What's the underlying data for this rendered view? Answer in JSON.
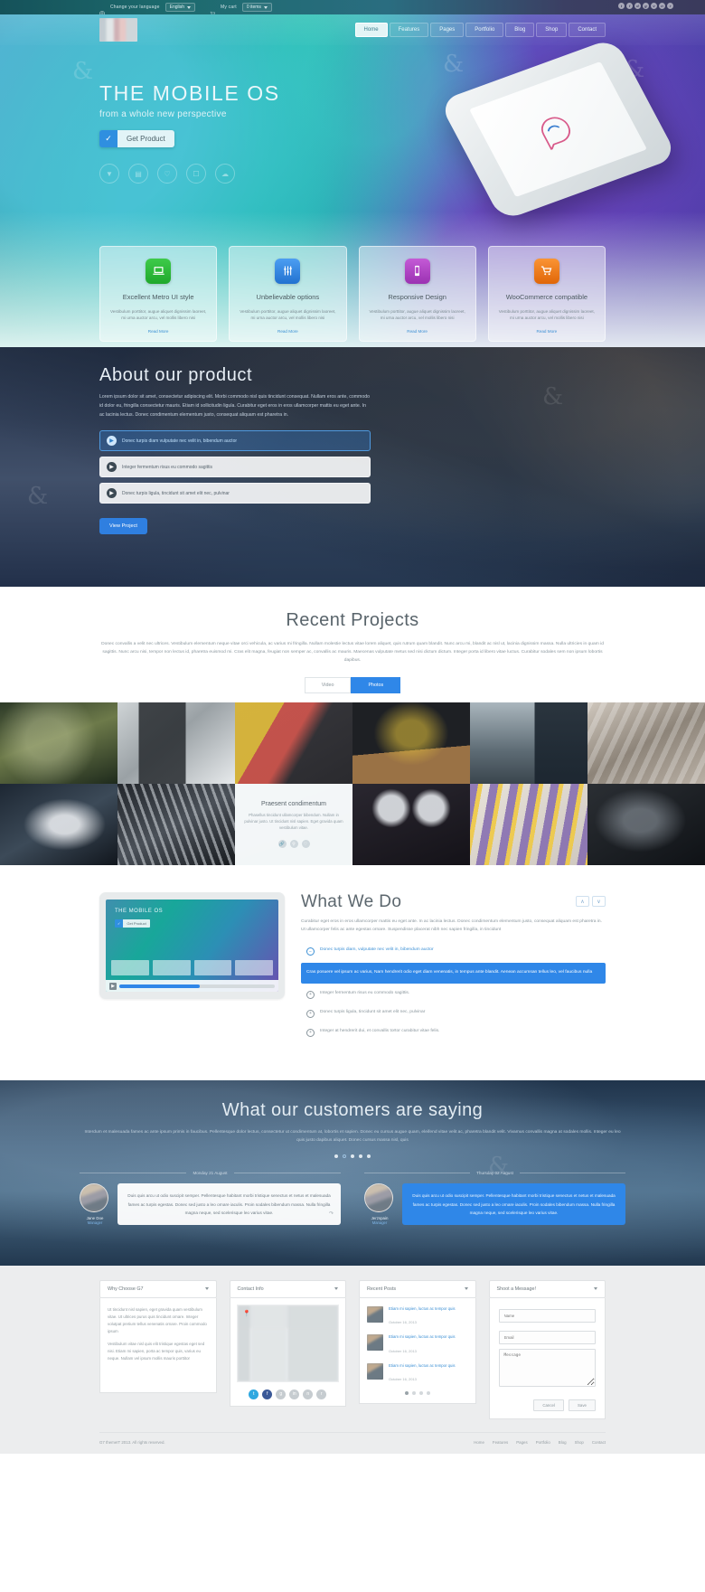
{
  "topbar": {
    "language_label": "Change your language",
    "language_value": "English",
    "cart_label": "My cart",
    "cart_value": "0 items",
    "globe_icon": "globe-icon",
    "cart_icon": "cart-icon",
    "social": [
      "twitter",
      "facebook",
      "dribbble",
      "google-plus",
      "vimeo",
      "flickr",
      "rss"
    ]
  },
  "nav": {
    "logo_alt": "site-logo",
    "items": [
      {
        "label": "Home",
        "active": true
      },
      {
        "label": "Features",
        "active": false
      },
      {
        "label": "Pages",
        "active": false
      },
      {
        "label": "Portfolio",
        "active": false
      },
      {
        "label": "Blog",
        "active": false
      },
      {
        "label": "Shop",
        "active": false
      },
      {
        "label": "Contact",
        "active": false
      }
    ]
  },
  "hero": {
    "title": "THE MOBILE OS",
    "subtitle": "from a whole new perspective",
    "button_label": "Get Product",
    "button_icon": "check-icon",
    "icons": [
      "filter-icon",
      "video-icon",
      "heart-icon",
      "camera-icon",
      "cloud-icon"
    ]
  },
  "features": [
    {
      "icon": "laptop-icon",
      "color": "#2dbb39",
      "title": "Excellent Metro\nUI style",
      "desc": "Vestibulum porttitor, augue aliquet dignissim laoreet, mi urna auctor arcu, vel mollis libero nisi",
      "more": "Read More"
    },
    {
      "icon": "sliders-icon",
      "color": "#2f87e8",
      "title": "Unbelievable\noptions",
      "desc": "Vestibulum porttitor, augue aliquet dignissim laoreet, mi urna auctor arcu, vel mollis libero nisi",
      "more": "Read More"
    },
    {
      "icon": "mobile-icon",
      "color": "#b44bc6",
      "title": "Responsive\nDesign",
      "desc": "Vestibulum porttitor, augue aliquet dignissim laoreet, mi urna auctor arcu, vel mollis libero nisi",
      "more": "Read More"
    },
    {
      "icon": "cart-badge-icon",
      "color": "#ef7a1e",
      "title": "WooCommerce\ncompatible",
      "desc": "Vestibulum porttitor, augue aliquet dignissim laoreet, mi urna auctor arcu, vel mollis libero nisi",
      "more": "Read More"
    }
  ],
  "about": {
    "title": "About our product",
    "paragraph": "Lorem ipsum dolor sit amet, consectetur adipiscing elit. Morbi commodo nisl quis tincidunt consequat. Nullam eros ante, commodo id dolor eu, fringilla consectetur mauris. Etiam id sollicitudin ligula. Curabitur eget eros in eros ullamcorper mattis eu eget ante. In ac lacinia lectus. Donec condimentum elementum justo, consequat aliquam est pharetra in.",
    "accordion": [
      {
        "text": "Donec turpis diam vulputate nec velit in, bibendum auctor",
        "open": true,
        "icon": "play-icon"
      },
      {
        "text": "Integer fermentum risus eu commodo sagittis",
        "open": false,
        "icon": "play-icon"
      },
      {
        "text": "Donec turpis ligula, tincidunt sit amet elit nec, pulvinar",
        "open": false,
        "icon": "play-icon"
      }
    ],
    "button_label": "View Project"
  },
  "projects": {
    "title": "Recent Projects",
    "paragraph": "Donec convallis a velit nec ultrices. Vestibulum elementum neque vitae orci vehicula, ac varius mi fringilla. Nullam molestie lectus vitae lorem aliquet, quis rutrum quam blandit. Nunc arcu mi, blandit ac nisl ut, lacinia dignissim massa. Nulla ultricies in quam id sagittis. Nunc arcu nisi, tempor non lectus id, pharetra euismod mi. Cras elit magna, feugiat non semper ac, convallis ac mauris. Maecenas vulputate metus sed nisi dictum dictum. Integer porta id libero vitae luctus. Curabitur sodales sem non ipsum lobortis dapibus.",
    "tabs": [
      {
        "label": "Video",
        "selected": false
      },
      {
        "label": "Photos",
        "selected": true
      }
    ],
    "caption_card": {
      "title": "Praesent condimentum",
      "desc": "Phasellus tincidunt ullamcorper bibendum. Nullam in pulvinar justo. Ut tincidunt nisl sapien. Eget gravida quam vestibulum vitae.",
      "actions": [
        "link-icon",
        "search-icon",
        "heart-icon"
      ]
    },
    "tile_labels": [
      "book-cover-tile",
      "tablet-device-tile",
      "phone-apps-tile",
      "desk-imac-tile",
      "mountain-brightness-tile",
      "sheets-tile",
      "fabric-tile",
      "sneakers-tile",
      "caption-tile",
      "reel-to-reel-tile",
      "synth-keys-tile",
      "dark-product-tile"
    ]
  },
  "what_we_do": {
    "title": "What We Do",
    "paragraph": "Curabitur eget eros in eros ullamcorper mattis eu eget ante. In ac lacinia lectus. Donec condimentum elementum justo, consequat aliquam est pharetra in. Ut ullamcorper felis ac ante egestas ornare. Suspendisse placerat nibh nec sapien fringilla, in tincidunt",
    "prev_icon": "chevron-up-icon",
    "next_icon": "chevron-down-icon",
    "tablet": {
      "title": "THE MOBILE OS",
      "button_label": "Get Product",
      "play_icon": "play-icon",
      "progress": 52
    },
    "items": [
      {
        "text": "Donec turpis diam, vulputate nec velit in, bibendum auctor",
        "state": "link"
      },
      {
        "text": "Cras posuere vel ipsum ac varius, Nam hendrerit odio eget diam venenatis, in tempus ante blandit. Aenean accumsan tellus leo, vel faucibus nulla",
        "state": "open"
      },
      {
        "text": "Integer fermentum risus eu commodo sagittis.",
        "state": "plain"
      },
      {
        "text": "Donec turpis ligula, tincidunt sit amet elit nec, pulvinar",
        "state": "plain"
      },
      {
        "text": "Integer at hendrerit dui, et convallis tortor curabitur vitae felis.",
        "state": "plain"
      }
    ]
  },
  "testimonials": {
    "title": "What our customers are saying",
    "paragraph": "Interdum et malesuada fames ac ante ipsum primis in faucibus. Pellentesque dolor lectus, consectetur ut condimentum at, lobortis et sapien. Donec eu cursus augue quam, eleifend vitae velit ac, pharetra blandit velit. Vivamus convallis magna at sodales mollis. Integer eu leo quis justo dapibus aliquet. Donec cursus massa nisl, quis",
    "dots": [
      true,
      false,
      true,
      true,
      true
    ],
    "items": [
      {
        "date": "Monday 21 August",
        "name": "Jane Doe",
        "role": "Manager",
        "quote": "Duis quis arcu ut odio suscipit semper. Pellentesque habitant morbi tristique senectus et netus et malesuada fames ac turpis egestas. Donec sed justo a leo ornare iaculis. Proin sodales bibendum massa. Nulla fringilla magna neque, sed scelerisque leo varius vitae.",
        "highlight": false,
        "share_icon": "share-icon"
      },
      {
        "date": "Thursday 02 August",
        "name": "Jerzspain",
        "role": "Manager",
        "quote": "Duis quis arcu ut odio suscipit semper. Pellentesque habitant morbi tristique senectus et netus et malesuada fames ac turpis egestas. Donec sed justo a leo ornare iaculis. Proin sodales bibendum massa. Nulla fringilla magna neque, sed scelerisque leo varius vitae.",
        "highlight": true,
        "share_icon": "share-icon"
      }
    ]
  },
  "footer": {
    "widgets": [
      {
        "title": "Why Choose G7",
        "caret": "chevron-down-icon",
        "paragraphs": [
          "Ut tincidunt nisl sapien, eget gravida quam vestibulum vitae. Ut ultrices purus quis tincidunt ornare. Integer volutpat pretium tellus venenatis ornare. Proin commodo ipsum",
          "Vestibulum vitae nisl quis elit tristique egestas eget sed nisi. Etiam mi sapien, porta ac tempor quis, varius eu neque. Nullam vel ipsum mollis mauris porttitor"
        ]
      },
      {
        "title": "Contact Info",
        "caret": "chevron-down-icon",
        "map_icon": "map-pin-icon",
        "socials": [
          "twitter",
          "facebook",
          "google-plus",
          "linkedin",
          "flickr",
          "rss"
        ]
      },
      {
        "title": "Recent Posts",
        "caret": "chevron-down-icon",
        "posts": [
          {
            "title": "Etiam mi sapien, luctus ac tempor quis",
            "date": "October 16, 2013"
          },
          {
            "title": "Etiam mi sapien, luctus ac tempor quis",
            "date": "October 16, 2013"
          },
          {
            "title": "Etiam mi sapien, luctus ac tempor quis",
            "date": "October 16, 2013"
          }
        ]
      },
      {
        "title": "Shoot a Message!",
        "caret": "chevron-down-icon",
        "fields": [
          {
            "placeholder": "Name",
            "type": "text"
          },
          {
            "placeholder": "Email",
            "type": "text"
          },
          {
            "placeholder": "Message",
            "type": "textarea"
          }
        ],
        "cancel_label": "Cancel",
        "save_label": "Save"
      }
    ],
    "copyright": "G7 themeIT 2013. All rights reserved.",
    "links": [
      "Home",
      "Features",
      "Pages",
      "Portfolio",
      "Blog",
      "Shop",
      "Contact"
    ]
  },
  "colors": {
    "accent_blue": "#2f87e8",
    "green": "#2dbb39",
    "purple": "#b44bc6",
    "orange": "#ef7a1e",
    "link": "#3b8fd4"
  }
}
